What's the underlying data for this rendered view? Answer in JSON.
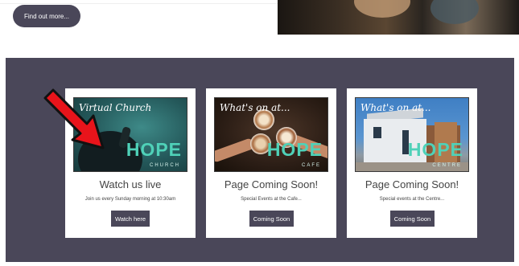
{
  "top": {
    "find_out_more_label": "Find out more..."
  },
  "cards": [
    {
      "image_label": "Virtual Church",
      "brand": "HOPE",
      "brand_sub": "CHURCH",
      "title": "Watch us live",
      "description": "Join us every Sunday morning at 10:30am",
      "button_label": "Watch here"
    },
    {
      "image_label": "What's on at...",
      "brand": "HOPE",
      "brand_sub": "CAFE",
      "title": "Page Coming Soon!",
      "description": "Special Events at the Cafe...",
      "button_label": "Coming Soon"
    },
    {
      "image_label": "What's on at...",
      "brand": "HOPE",
      "brand_sub": "CENTRE",
      "title": "Page Coming Soon!",
      "description": "Special events at the Centre...",
      "button_label": "Coming Soon"
    }
  ],
  "colors": {
    "band": "#4a4759",
    "button": "#4a4759",
    "brand_teal": "#4fd1b8",
    "arrow_red": "#e8141b"
  },
  "icons": {
    "pointer": "red-arrow-icon"
  }
}
